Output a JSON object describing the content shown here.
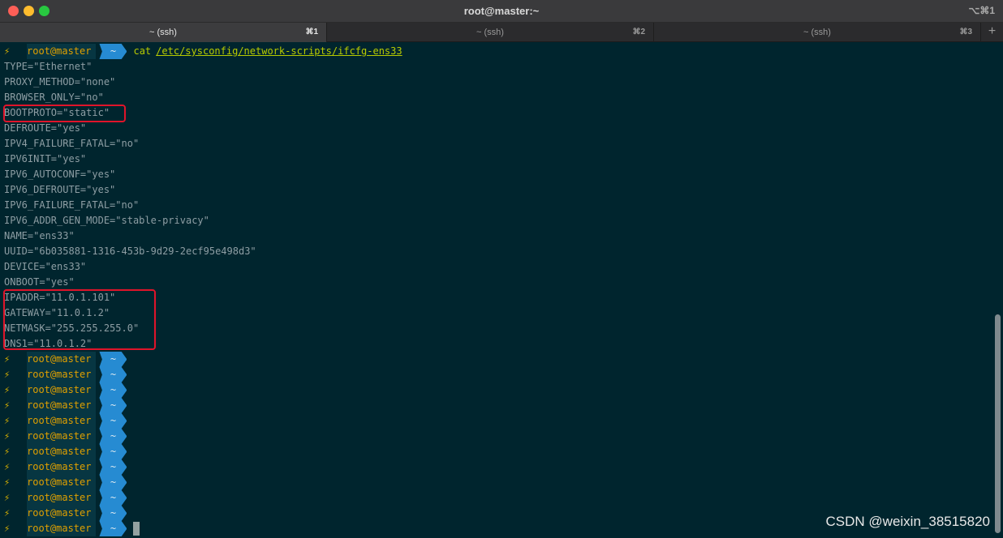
{
  "window": {
    "title": "root@master:~",
    "shortcut": "⌥⌘1"
  },
  "tabs": [
    {
      "label": "~ (ssh)",
      "key": "⌘1"
    },
    {
      "label": "~ (ssh)",
      "key": "⌘2"
    },
    {
      "label": "~ (ssh)",
      "key": "⌘3"
    }
  ],
  "tab_add_label": "+",
  "prompt": {
    "bolt": "⚡",
    "user": "root@master",
    "dir": "~"
  },
  "command": {
    "name": "cat",
    "arg": "/etc/sysconfig/network-scripts/ifcfg-ens33"
  },
  "output_lines": [
    "TYPE=\"Ethernet\"",
    "PROXY_METHOD=\"none\"",
    "BROWSER_ONLY=\"no\"",
    "BOOTPROTO=\"static\"",
    "DEFROUTE=\"yes\"",
    "IPV4_FAILURE_FATAL=\"no\"",
    "IPV6INIT=\"yes\"",
    "IPV6_AUTOCONF=\"yes\"",
    "IPV6_DEFROUTE=\"yes\"",
    "IPV6_FAILURE_FATAL=\"no\"",
    "IPV6_ADDR_GEN_MODE=\"stable-privacy\"",
    "NAME=\"ens33\"",
    "UUID=\"6b035881-1316-453b-9d29-2ecf95e498d3\"",
    "DEVICE=\"ens33\"",
    "ONBOOT=\"yes\"",
    "IPADDR=\"11.0.1.101\"",
    "GATEWAY=\"11.0.1.2\"",
    "NETMASK=\"255.255.255.0\"",
    "DNS1=\"11.0.1.2\""
  ],
  "empty_prompt_count": 12,
  "watermark": "CSDN @weixin_38515820",
  "colors": {
    "background": "#00252e",
    "highlight": "#e0142a",
    "prompt_segment": "#268bd2"
  }
}
